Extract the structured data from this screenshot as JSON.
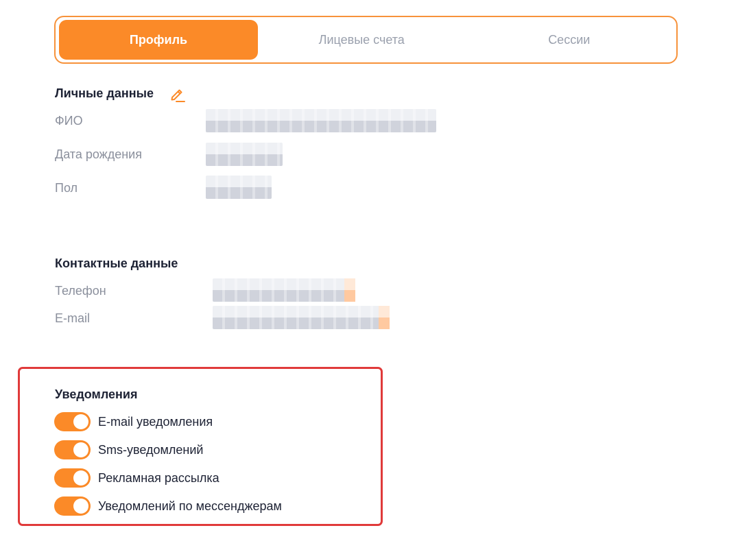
{
  "tabs": [
    {
      "label": "Профиль",
      "active": true
    },
    {
      "label": "Лицевые счета",
      "active": false
    },
    {
      "label": "Сессии",
      "active": false
    }
  ],
  "personal": {
    "title": "Личные данные",
    "edit_icon": "pencil-icon",
    "fields": [
      {
        "label": "ФИО"
      },
      {
        "label": "Дата рождения"
      },
      {
        "label": "Пол"
      }
    ]
  },
  "contacts": {
    "title": "Контактные данные",
    "fields": [
      {
        "label": "Телефон"
      },
      {
        "label": "E-mail"
      }
    ]
  },
  "notifications": {
    "title": "Уведомления",
    "toggles": [
      {
        "label": "E-mail уведомления",
        "on": true
      },
      {
        "label": "Sms-уведомлений",
        "on": true
      },
      {
        "label": "Рекламная рассылка",
        "on": true
      },
      {
        "label": "Уведомлений по мессенджерам",
        "on": true
      }
    ]
  },
  "colors": {
    "accent": "#fb8a28",
    "highlight_border": "#e03a3a",
    "muted_text": "#8a8f9c"
  }
}
